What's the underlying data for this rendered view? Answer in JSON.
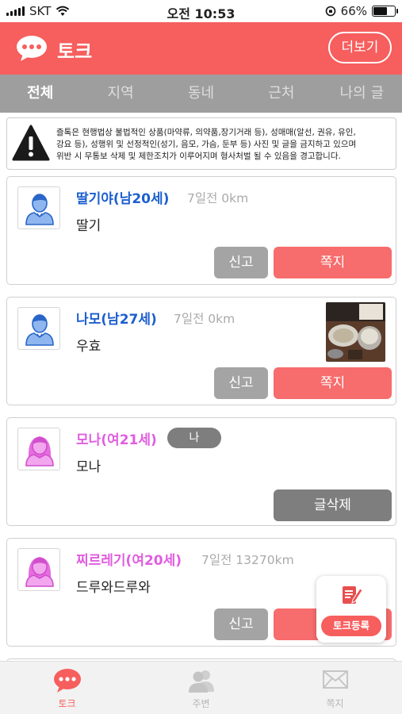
{
  "status_bar": {
    "carrier": "SKT",
    "time": "오전 10:53",
    "battery": "66%",
    "battery_level": 0.66
  },
  "header": {
    "title": "토크",
    "more_label": "더보기",
    "accent_color": "#f75e5e"
  },
  "tabs": [
    {
      "label": "전체",
      "active": true
    },
    {
      "label": "지역",
      "active": false
    },
    {
      "label": "동네",
      "active": false
    },
    {
      "label": "근처",
      "active": false
    },
    {
      "label": "나의 글",
      "active": false
    }
  ],
  "notice": {
    "icon": "warning-icon",
    "text": "즐톡은 현행법상 불법적인 상품(마약류, 의약품,장기거래 등), 성매매(알선, 권유, 유인,\n강요 등), 성행위 및 선정적인(성기, 음모, 가슴, 둔부 등) 사진 및 글을 금지하고 있으며\n위반 시 무통보 삭제 및 제한조치가 이루어지며 형사처벌 될 수 있음을 경고합니다."
  },
  "posts": [
    {
      "name": "딸기야(남20세)",
      "gender": "male",
      "meta": "7일전 0km",
      "message": "딸기",
      "report_label": "신고",
      "msg_label": "쪽지"
    },
    {
      "name": "나모(남27세)",
      "gender": "male",
      "meta": "7일전 0km",
      "message": "우효",
      "report_label": "신고",
      "msg_label": "쪽지"
    },
    {
      "name": "모나(여21세)",
      "gender": "female",
      "badge": "나",
      "message": "모나",
      "delete_label": "글삭제"
    },
    {
      "name": "찌르레기(여20세)",
      "gender": "female",
      "meta": "7일전 13270km",
      "message": "드루와드루와",
      "report_label": "신고",
      "msg_label": "쪽지"
    }
  ],
  "fab": {
    "label": "토크등록",
    "icon": "edit-post-icon"
  },
  "bottom_nav": [
    {
      "label": "토크",
      "icon": "chat-bubble-icon",
      "active": true
    },
    {
      "label": "주변",
      "icon": "people-icon",
      "active": false
    },
    {
      "label": "쪽지",
      "icon": "envelope-icon",
      "active": false
    }
  ]
}
